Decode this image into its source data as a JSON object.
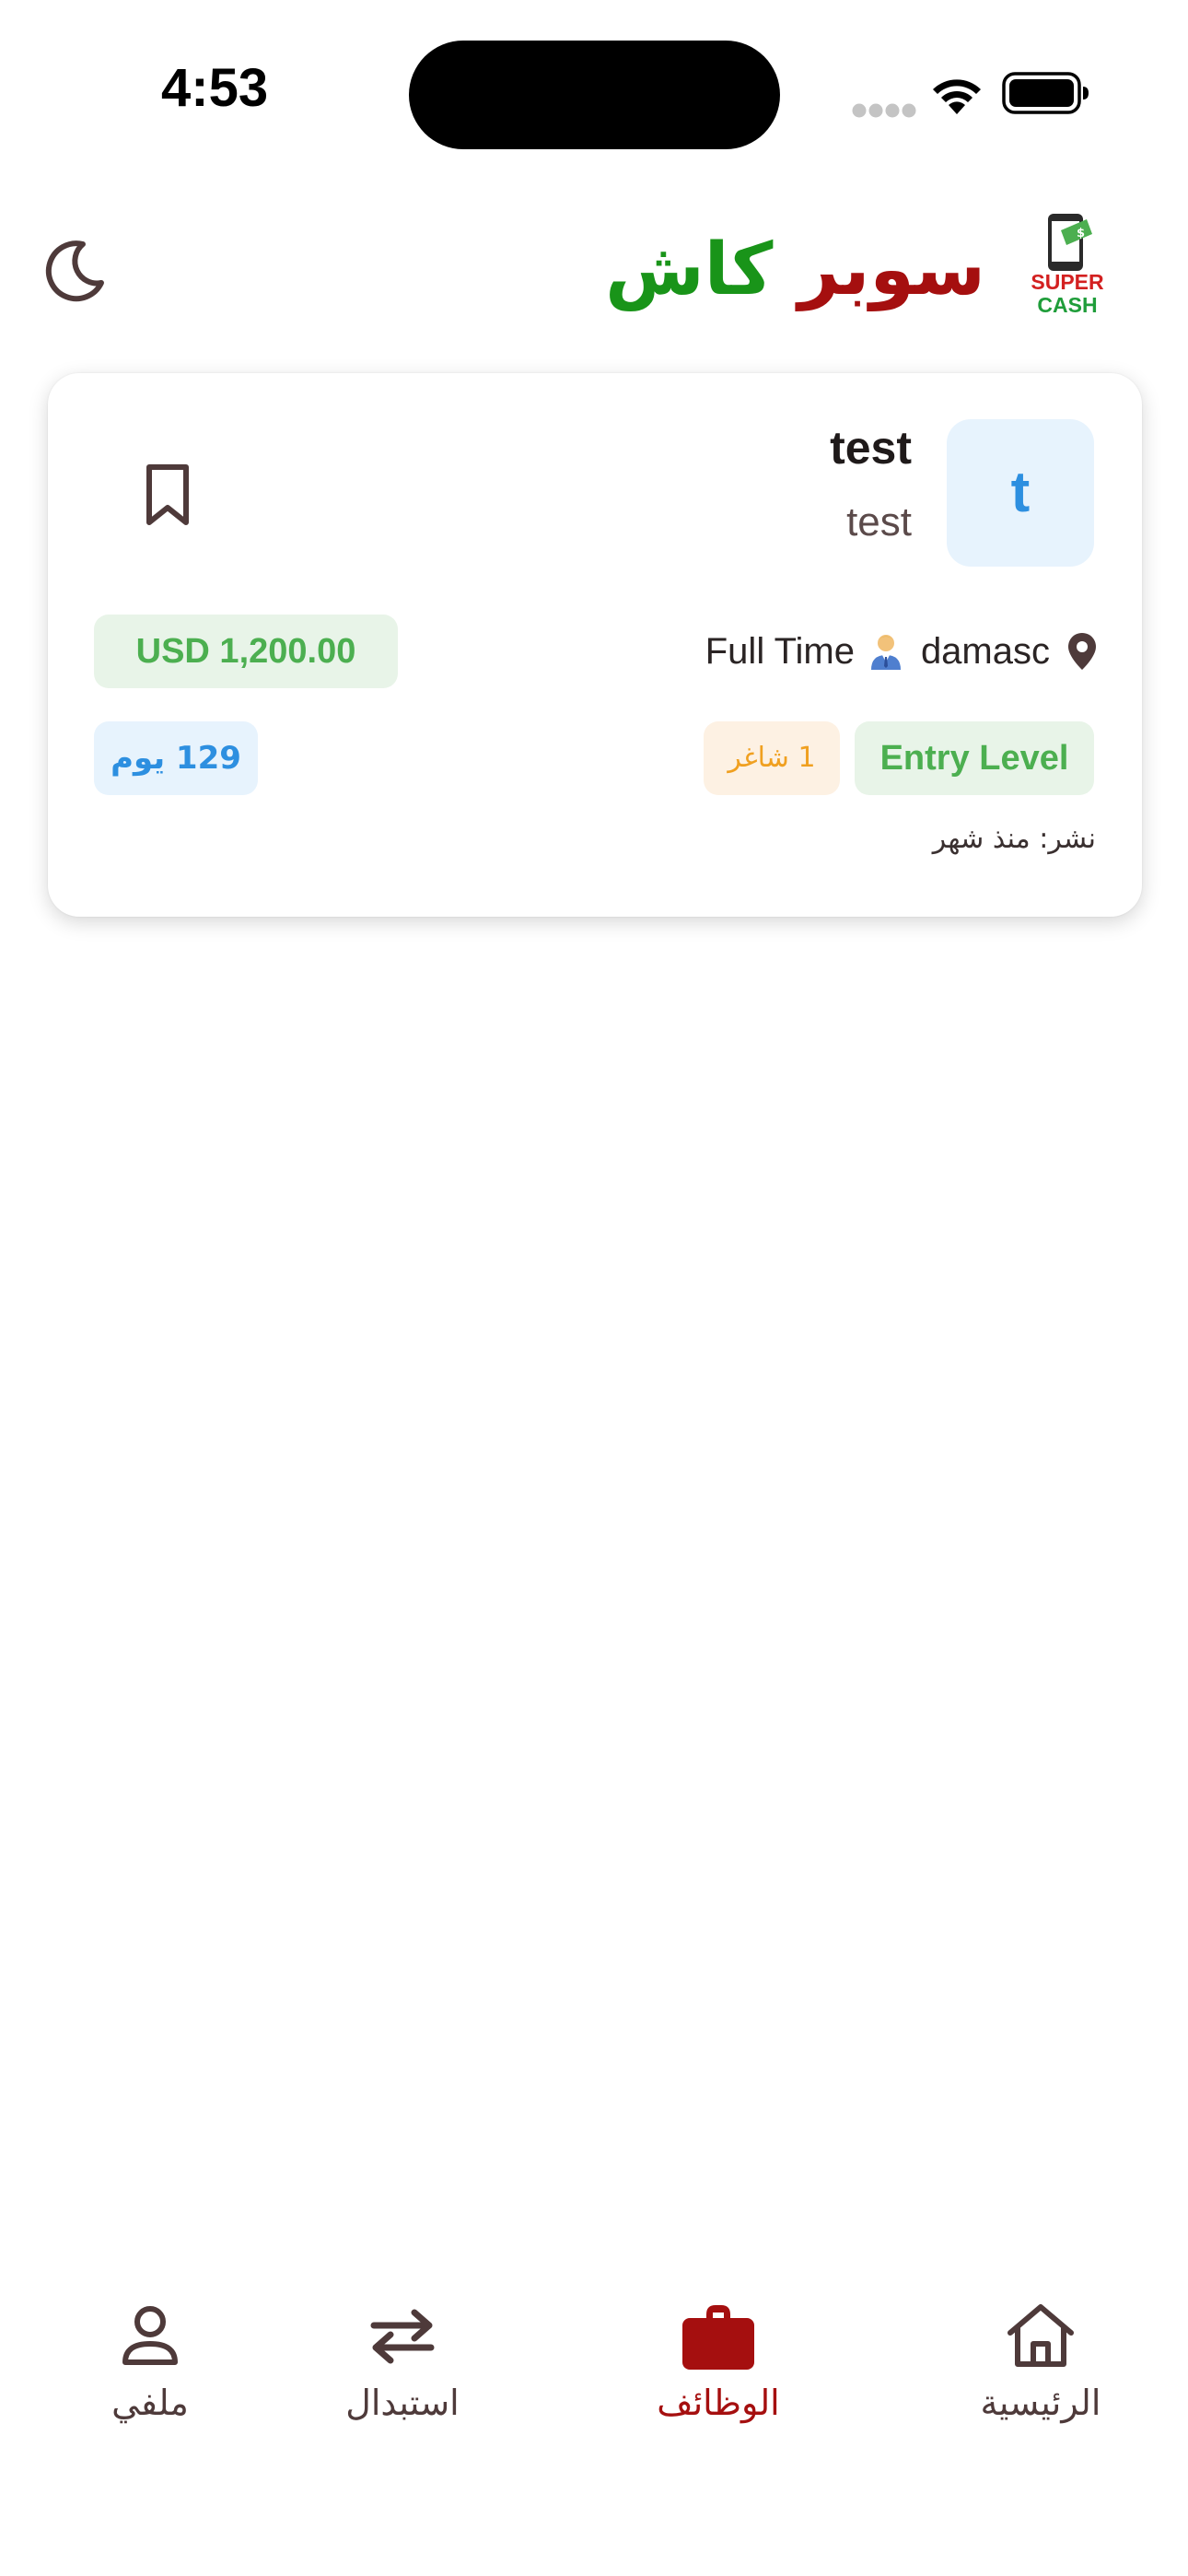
{
  "status_bar": {
    "time": "4:53",
    "icons": [
      "cellular-signal-icon",
      "wifi-icon",
      "battery-icon"
    ]
  },
  "header": {
    "brand_part_red": "سوبر",
    "brand_part_green": "كاش",
    "logo_line1": "SUPER",
    "logo_line2": "CASH",
    "theme_toggle_icon": "moon-icon"
  },
  "job_card": {
    "avatar_letter": "t",
    "title": "test",
    "company": "test",
    "bookmark_icon": "bookmark-icon",
    "location": "damasc",
    "job_type": "Full Time",
    "salary": "USD 1,200.00",
    "experience_level": "Entry Level",
    "vacancies": "1 شاغر",
    "days_left": "129 يوم",
    "posted": "نشر: منذ شهر"
  },
  "bottom_nav": {
    "active": "jobs",
    "items": [
      {
        "key": "profile",
        "label": "ملفي",
        "icon": "person-icon"
      },
      {
        "key": "exchange",
        "label": "استبدال",
        "icon": "swap-arrows-icon"
      },
      {
        "key": "jobs",
        "label": "الوظائف",
        "icon": "briefcase-icon"
      },
      {
        "key": "home",
        "label": "الرئيسية",
        "icon": "home-icon"
      }
    ]
  },
  "colors": {
    "brand_red": "#a50f0f",
    "brand_green": "#199419",
    "salary_green": "#4caf50",
    "days_blue": "#2d8fe0",
    "vacancy_orange": "#f0a020"
  }
}
